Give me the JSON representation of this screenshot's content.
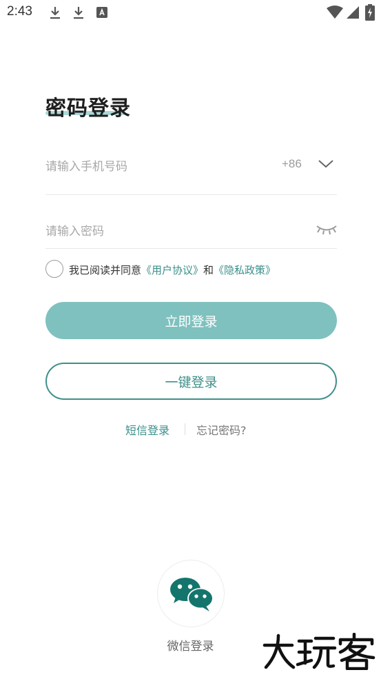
{
  "status_bar": {
    "time": "2:43",
    "icons": [
      "download-icon",
      "download-icon",
      "app-notification-icon",
      "wifi-icon",
      "signal-icon",
      "battery-charging-icon"
    ]
  },
  "login": {
    "title": "密码登录",
    "phone_placeholder": "请输入手机号码",
    "country_code": "+86",
    "password_placeholder": "请输入密码",
    "agreement": {
      "prefix": "我已阅读并同意",
      "user_agreement": "《用户协议》",
      "and": "和",
      "privacy_policy": "《隐私政策》"
    },
    "login_button": "立即登录",
    "one_click_button": "一键登录",
    "sms_login": "短信登录",
    "forgot_password": "忘记密码?"
  },
  "third_party": {
    "wechat_label": "微信登录"
  },
  "watermark": {
    "text": "大玩客"
  },
  "colors": {
    "accent": "#3e8f8a",
    "primary_button": "#7fc1bf",
    "wechat": "#14756d"
  }
}
